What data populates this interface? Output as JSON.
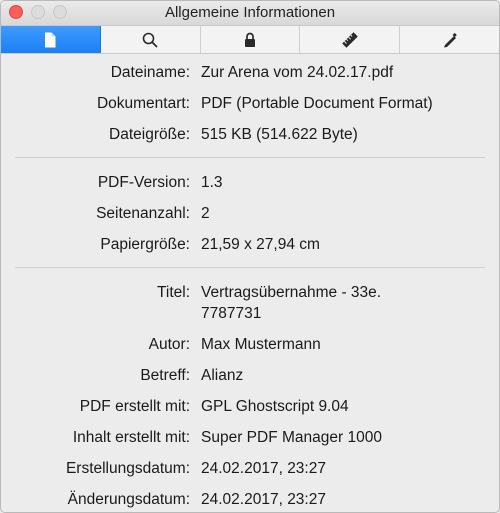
{
  "window": {
    "title": "Allgemeine Informationen"
  },
  "toolbar": {
    "tabs": [
      {
        "icon": "document-icon",
        "active": true
      },
      {
        "icon": "search-icon"
      },
      {
        "icon": "lock-icon"
      },
      {
        "icon": "ruler-icon"
      },
      {
        "icon": "pencil-icon"
      }
    ]
  },
  "colors": {
    "accent": "#1c7ff4",
    "close": "#fc5f57"
  },
  "info": {
    "dateiname": {
      "label": "Dateiname:",
      "value": "Zur Arena vom 24.02.17.pdf"
    },
    "dokumentart": {
      "label": "Dokumentart:",
      "value": "PDF (Portable Document Format)"
    },
    "dateigroesse": {
      "label": "Dateigröße:",
      "value": "515 KB (514.622 Byte)"
    },
    "pdf_version": {
      "label": "PDF-Version:",
      "value": "1.3"
    },
    "seitenanzahl": {
      "label": "Seitenanzahl:",
      "value": "2"
    },
    "papiergroesse": {
      "label": "Papiergröße:",
      "value": "21,59 x 27,94 cm"
    },
    "titel": {
      "label": "Titel:",
      "value": "Vertragsübernahme - 33e.\n7787731"
    },
    "autor": {
      "label": "Autor:",
      "value": "Max Mustermann"
    },
    "betreff": {
      "label": "Betreff:",
      "value": "Alianz"
    },
    "pdf_erstellt": {
      "label": "PDF erstellt mit:",
      "value": "GPL Ghostscript 9.04"
    },
    "inhalt_erstellt": {
      "label": "Inhalt erstellt mit:",
      "value": "Super PDF Manager 1000"
    },
    "erstellungsdatum": {
      "label": "Erstellungsdatum:",
      "value": "24.02.2017, 23:27"
    },
    "aenderungsdatum": {
      "label": "Änderungsdatum:",
      "value": "24.02.2017, 23:27"
    }
  }
}
